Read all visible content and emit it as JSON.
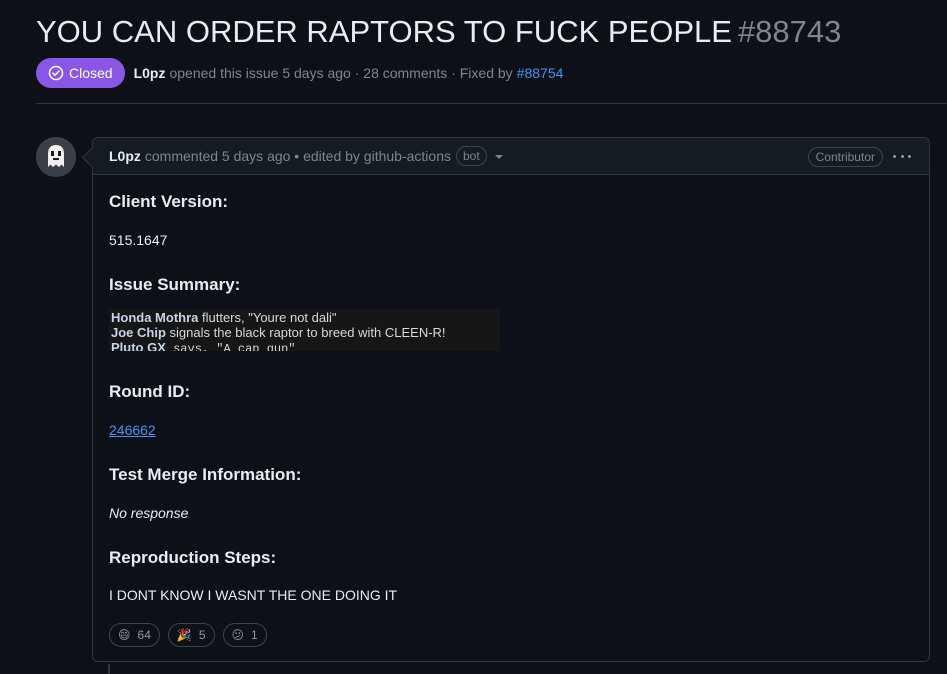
{
  "issue": {
    "title": "YOU CAN ORDER RAPTORS TO FUCK PEOPLE",
    "number": "#88743",
    "state": "Closed",
    "author": "L0pz",
    "opened_text": "opened this issue 5 days ago · 28 comments · Fixed by",
    "fixed_by": "#88754"
  },
  "comment": {
    "author": "L0pz",
    "meta_text": "commented 5 days ago • edited by github-actions",
    "bot_label": "bot",
    "role_badge": "Contributor",
    "sections": {
      "client_version_heading": "Client Version:",
      "client_version_value": "515.1647",
      "issue_summary_heading": "Issue Summary:",
      "round_id_heading": "Round ID:",
      "round_id_value": "246662",
      "test_merge_heading": "Test Merge Information:",
      "test_merge_value": "No response",
      "repro_heading": "Reproduction Steps:",
      "repro_value": "I DONT KNOW I WASNT THE ONE DOING IT"
    },
    "chat_log": [
      {
        "speaker": "Honda Mothra",
        "text": " flutters, \"Youre not dali\""
      },
      {
        "speaker": "Joe Chip",
        "text": " signals the black raptor to breed with CLEEN-R!"
      },
      {
        "speaker": "Pluto GX",
        "text": " says, \"A cap gun\""
      }
    ],
    "reactions": [
      {
        "emoji": "😄",
        "icon": "smile-emoji-icon",
        "count": "64"
      },
      {
        "emoji": "🎉",
        "icon": "tada-emoji-icon",
        "count": "5"
      },
      {
        "emoji": "😕",
        "icon": "confused-emoji-icon",
        "count": "1"
      }
    ]
  },
  "colors": {
    "background": "#0d1117",
    "closed_badge": "#8957e5",
    "link": "#4493f8",
    "muted": "#7d8590",
    "border": "#30363d"
  }
}
